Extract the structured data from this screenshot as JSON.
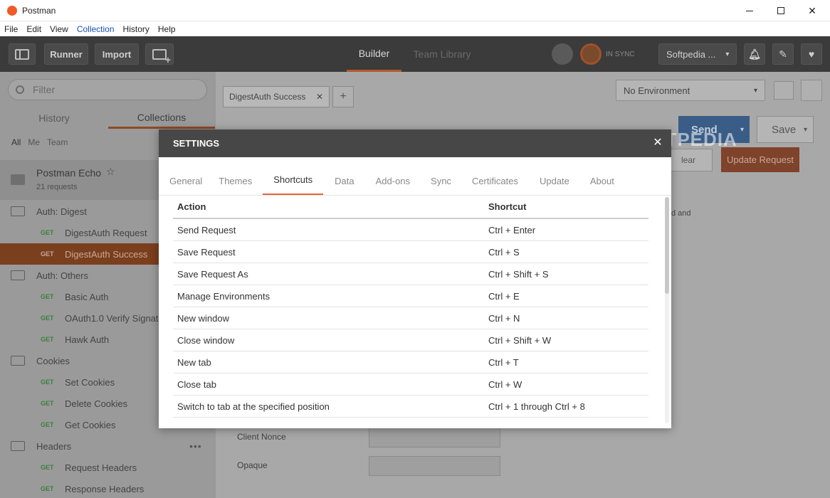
{
  "window": {
    "title": "Postman"
  },
  "menu": [
    "File",
    "Edit",
    "View",
    "Collection",
    "History",
    "Help"
  ],
  "toolbar": {
    "runner": "Runner",
    "import": "Import",
    "tabs": [
      "Builder",
      "Team Library"
    ],
    "sync_label": "IN SYNC",
    "account": "Softpedia ..."
  },
  "sidebar": {
    "filter_placeholder": "Filter",
    "tabs": [
      "History",
      "Collections"
    ],
    "scope": [
      "All",
      "Me",
      "Team"
    ],
    "collection_name": "Postman Echo",
    "collection_count": "21 requests",
    "items": [
      {
        "type": "folder",
        "label": "Auth: Digest"
      },
      {
        "type": "request",
        "method": "GET",
        "label": "DigestAuth Request"
      },
      {
        "type": "request",
        "method": "GET",
        "label": "DigestAuth Success",
        "selected": true
      },
      {
        "type": "folder",
        "label": "Auth: Others"
      },
      {
        "type": "request",
        "method": "GET",
        "label": "Basic Auth"
      },
      {
        "type": "request",
        "method": "GET",
        "label": "OAuth1.0 Verify Signatu"
      },
      {
        "type": "request",
        "method": "GET",
        "label": "Hawk Auth"
      },
      {
        "type": "folder",
        "label": "Cookies"
      },
      {
        "type": "request",
        "method": "GET",
        "label": "Set Cookies"
      },
      {
        "type": "request",
        "method": "GET",
        "label": "Delete Cookies"
      },
      {
        "type": "request",
        "method": "GET",
        "label": "Get Cookies"
      },
      {
        "type": "folder",
        "label": "Headers"
      },
      {
        "type": "request",
        "method": "GET",
        "label": "Request Headers"
      },
      {
        "type": "request",
        "method": "GET",
        "label": "Response Headers"
      }
    ]
  },
  "main": {
    "request_tab": "DigestAuth Success",
    "environment": "No Environment",
    "send": "Send",
    "save": "Save",
    "clear": "lear",
    "update_request": "Update Request",
    "partial_text": "d and",
    "fields": [
      "Client Nonce",
      "Opaque"
    ]
  },
  "settings": {
    "title": "SETTINGS",
    "tabs": [
      "General",
      "Themes",
      "Shortcuts",
      "Data",
      "Add-ons",
      "Sync",
      "Certificates",
      "Update",
      "About"
    ],
    "active_tab": "Shortcuts",
    "columns": [
      "Action",
      "Shortcut"
    ],
    "rows": [
      [
        "Send Request",
        "Ctrl + Enter"
      ],
      [
        "Save Request",
        "Ctrl + S"
      ],
      [
        "Save Request As",
        "Ctrl + Shift + S"
      ],
      [
        "Manage Environments",
        "Ctrl + E"
      ],
      [
        "New window",
        "Ctrl + N"
      ],
      [
        "Close window",
        "Ctrl + Shift + W"
      ],
      [
        "New tab",
        "Ctrl + T"
      ],
      [
        "Close tab",
        "Ctrl + W"
      ],
      [
        "Switch to tab at the specified position",
        "Ctrl + 1 through Ctrl + 8"
      ]
    ]
  },
  "watermark": "SOFTPEDIA"
}
